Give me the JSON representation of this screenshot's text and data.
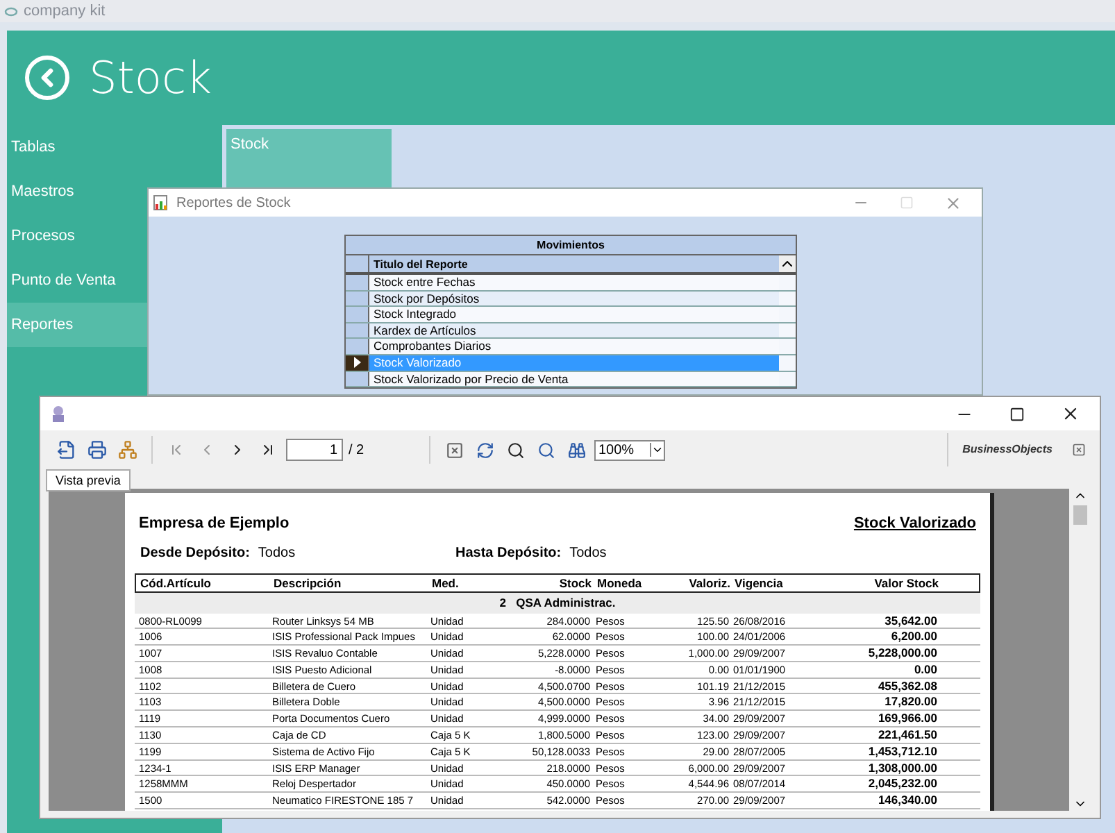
{
  "app": {
    "title": "company kit",
    "header": "Stock"
  },
  "sidebar": {
    "items": [
      {
        "label": "Tablas",
        "selected": false
      },
      {
        "label": "Maestros",
        "selected": false
      },
      {
        "label": "Procesos",
        "selected": false
      },
      {
        "label": "Punto de Venta",
        "selected": false
      },
      {
        "label": "Reportes",
        "selected": true
      }
    ]
  },
  "tile": {
    "label": "Stock"
  },
  "dialog": {
    "title": "Reportes de Stock",
    "group": "Movimientos",
    "column": "Titulo del Reporte",
    "rows": [
      {
        "label": "Stock entre Fechas",
        "selected": false
      },
      {
        "label": "Stock por Depósitos",
        "selected": false
      },
      {
        "label": "Stock Integrado",
        "selected": false
      },
      {
        "label": "Kardex de Artículos",
        "selected": false
      },
      {
        "label": "Comprobantes Diarios",
        "selected": false
      },
      {
        "label": "Stock Valorizado",
        "selected": true
      },
      {
        "label": "Stock Valorizado por Precio de Venta",
        "selected": false
      }
    ]
  },
  "viewer": {
    "page": "1",
    "page_total": "/ 2",
    "zoom": "100%",
    "logo": "BusinessObjects",
    "tab": "Vista previa"
  },
  "report": {
    "company": "Empresa de Ejemplo",
    "title": "Stock Valorizado",
    "filters": [
      {
        "label": "Desde Depósito:",
        "value": "Todos"
      },
      {
        "label": "Hasta Depósito:",
        "value": "Todos"
      }
    ],
    "columns": [
      "Cód.Artículo",
      "Descripción",
      "Med.",
      "Stock",
      "Moneda",
      "Valoriz.",
      "Vigencia",
      "Valor Stock"
    ],
    "group": "2   QSA Administrac.",
    "rows": [
      [
        "0800-RL0099",
        "Router Linksys 54 MB",
        "Unidad",
        "284.0000",
        "Pesos",
        "125.50",
        "26/08/2016",
        "35,642.00"
      ],
      [
        "1006",
        "ISIS Professional Pack Impues",
        "Unidad",
        "62.0000",
        "Pesos",
        "100.00",
        "24/01/2006",
        "6,200.00"
      ],
      [
        "1007",
        "ISIS Revaluo Contable",
        "Unidad",
        "5,228.0000",
        "Pesos",
        "1,000.00",
        "29/09/2007",
        "5,228,000.00"
      ],
      [
        "1008",
        "ISIS Puesto Adicional",
        "Unidad",
        "-8.0000",
        "Pesos",
        "0.00",
        "01/01/1900",
        "0.00"
      ],
      [
        "1102",
        "Billetera de Cuero",
        "Unidad",
        "4,500.0700",
        "Pesos",
        "101.19",
        "21/12/2015",
        "455,362.08"
      ],
      [
        "1103",
        "Billetera Doble",
        "Unidad",
        "4,500.0000",
        "Pesos",
        "3.96",
        "21/12/2015",
        "17,820.00"
      ],
      [
        "1119",
        "Porta Documentos Cuero",
        "Unidad",
        "4,999.0000",
        "Pesos",
        "34.00",
        "29/09/2007",
        "169,966.00"
      ],
      [
        "1130",
        "Caja de CD",
        "Caja 5 K",
        "1,800.5000",
        "Pesos",
        "123.00",
        "29/09/2007",
        "221,461.50"
      ],
      [
        "1199",
        "Sistema de Activo Fijo",
        "Caja 5 K",
        "50,128.0033",
        "Pesos",
        "29.00",
        "28/07/2005",
        "1,453,712.10"
      ],
      [
        "1234-1",
        "ISIS ERP Manager",
        "Unidad",
        "218.0000",
        "Pesos",
        "6,000.00",
        "29/09/2007",
        "1,308,000.00"
      ],
      [
        "1258MMM",
        "Reloj Despertador",
        "Unidad",
        "450.0000",
        "Pesos",
        "4,544.96",
        "08/07/2014",
        "2,045,232.00"
      ],
      [
        "1500",
        "Neumatico FIRESTONE 185 7",
        "Unidad",
        "542.0000",
        "Pesos",
        "270.00",
        "29/09/2007",
        "146,340.00"
      ]
    ]
  }
}
